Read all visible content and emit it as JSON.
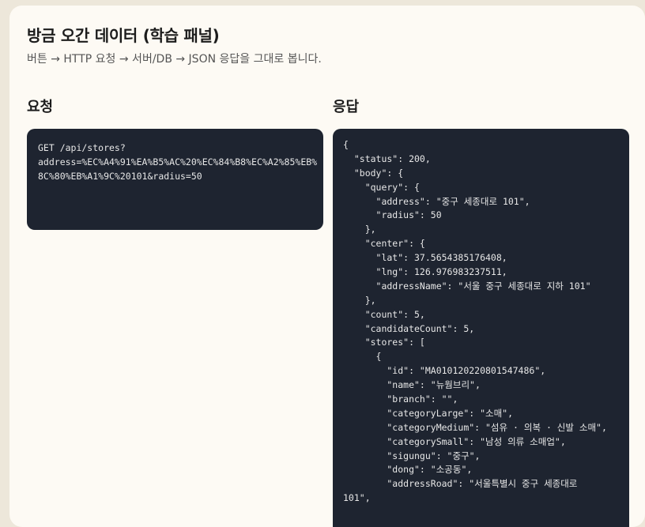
{
  "header": {
    "title": "방금 오간 데이터 (학습 패널)",
    "subtitle": "버튼 → HTTP 요청 → 서버/DB → JSON 응답을 그대로 봅니다."
  },
  "request": {
    "heading": "요청",
    "lines": [
      "GET /api/stores?",
      "address=%EC%A4%91%EA%B5%AC%20%EC%84%B8%EC%A2%85%EB%",
      "8C%80%EB%A1%9C%20101&radius=50"
    ]
  },
  "response": {
    "heading": "응답",
    "lines": [
      "{",
      "  \"status\": 200,",
      "  \"body\": {",
      "    \"query\": {",
      "      \"address\": \"중구 세종대로 101\",",
      "      \"radius\": 50",
      "    },",
      "    \"center\": {",
      "      \"lat\": 37.5654385176408,",
      "      \"lng\": 126.976983237511,",
      "      \"addressName\": \"서울 중구 세종대로 지하 101\"",
      "    },",
      "    \"count\": 5,",
      "    \"candidateCount\": 5,",
      "    \"stores\": [",
      "      {",
      "        \"id\": \"MA010120220801547486\",",
      "        \"name\": \"뉴웜브리\",",
      "        \"branch\": \"\",",
      "        \"categoryLarge\": \"소매\",",
      "        \"categoryMedium\": \"섬유 · 의복 · 신발 소매\",",
      "        \"categorySmall\": \"남성 의류 소매업\",",
      "        \"sigungu\": \"중구\",",
      "        \"dong\": \"소공동\",",
      "        \"addressRoad\": \"서울특별시 중구 세종대로",
      "101\","
    ]
  }
}
